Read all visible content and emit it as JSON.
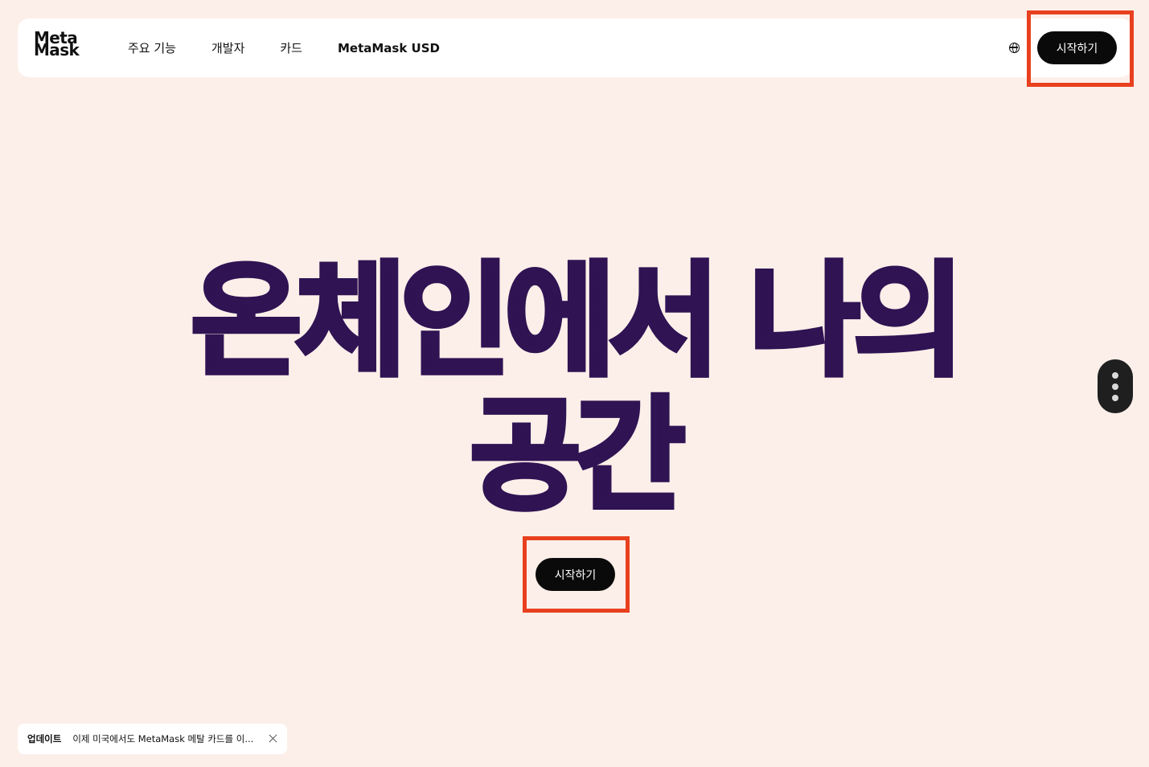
{
  "header": {
    "logo_line1": "Meta",
    "logo_line2": "Mask",
    "nav": [
      {
        "label": "주요 기능"
      },
      {
        "label": "개발자"
      },
      {
        "label": "카드"
      },
      {
        "label": "MetaMask USD"
      }
    ],
    "language_icon": "globe-icon",
    "cta_label": "시작하기"
  },
  "hero": {
    "title_line1": "온체인에서 나의",
    "title_line2": "공간",
    "cta_label": "시작하기"
  },
  "side_menu": {
    "icon": "more-vertical-icon"
  },
  "toast": {
    "tag": "업데이트",
    "text": "이제 미국에서도 MetaMask 메탈 카드를 이...",
    "close_icon": "close-icon"
  },
  "colors": {
    "background": "#fcefe9",
    "hero_text": "#2f1353",
    "button": "#0a0a0a",
    "highlight": "#e8401f"
  }
}
